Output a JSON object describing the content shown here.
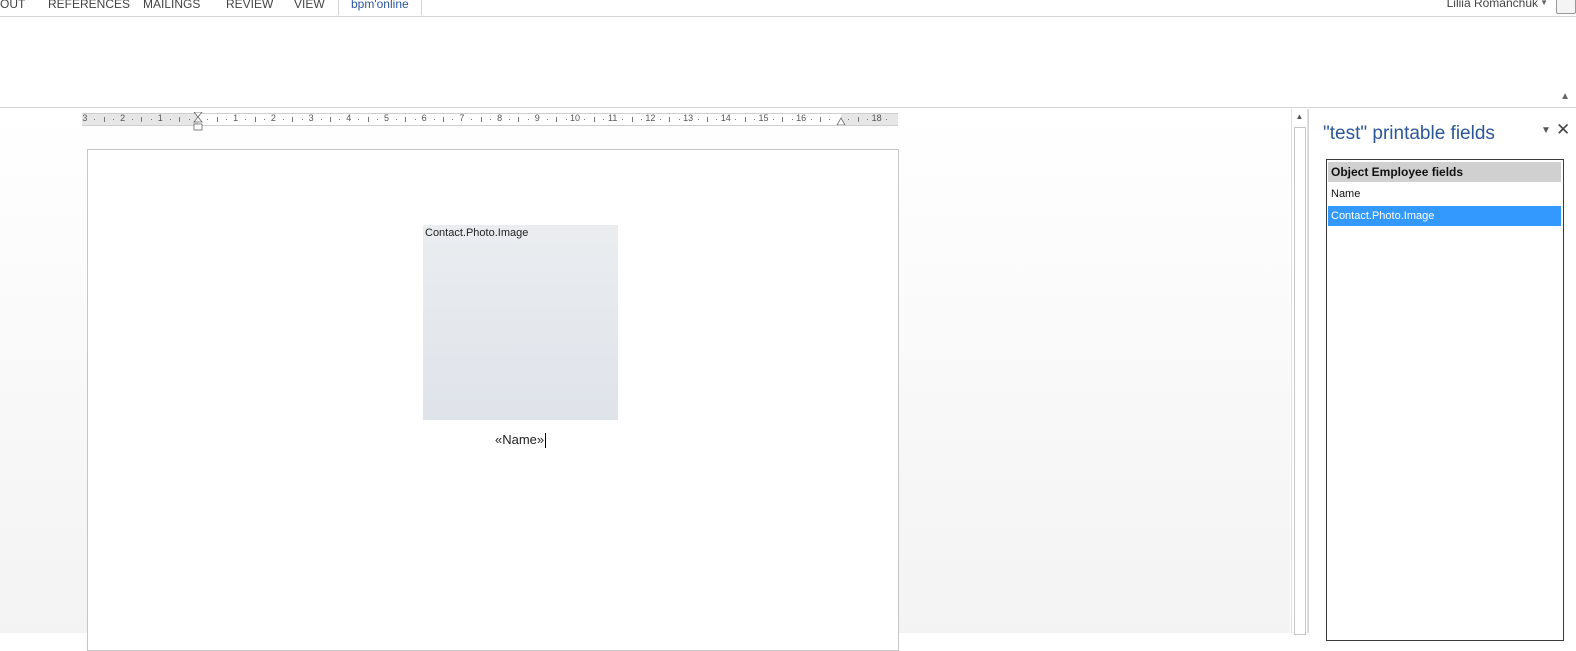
{
  "ribbon": {
    "tabs": [
      {
        "label": "OUT"
      },
      {
        "label": "REFERENCES"
      },
      {
        "label": "MAILINGS"
      },
      {
        "label": "REVIEW"
      },
      {
        "label": "VIEW"
      },
      {
        "label": "bpm'online"
      }
    ],
    "active_tab": "bpm'online",
    "user_name": "Liliia Romanchuk"
  },
  "ruler": {
    "left_labels": [
      "3",
      "2",
      "1"
    ],
    "right_labels": [
      "1",
      "2",
      "3",
      "4",
      "5",
      "6",
      "7",
      "8",
      "9",
      "10",
      "11",
      "12",
      "13",
      "14",
      "15",
      "16",
      "18"
    ]
  },
  "document": {
    "image_field_label": "Contact.Photo.Image",
    "merge_field_text": "«Name»"
  },
  "pane": {
    "title": "\"test\" printable fields",
    "list_header": "Object  Employee fields",
    "items": [
      {
        "label": "Name",
        "selected": false
      },
      {
        "label": "Contact.Photo.Image",
        "selected": true
      }
    ]
  },
  "colors": {
    "accent": "#2b579a",
    "selection": "#3399ff"
  }
}
